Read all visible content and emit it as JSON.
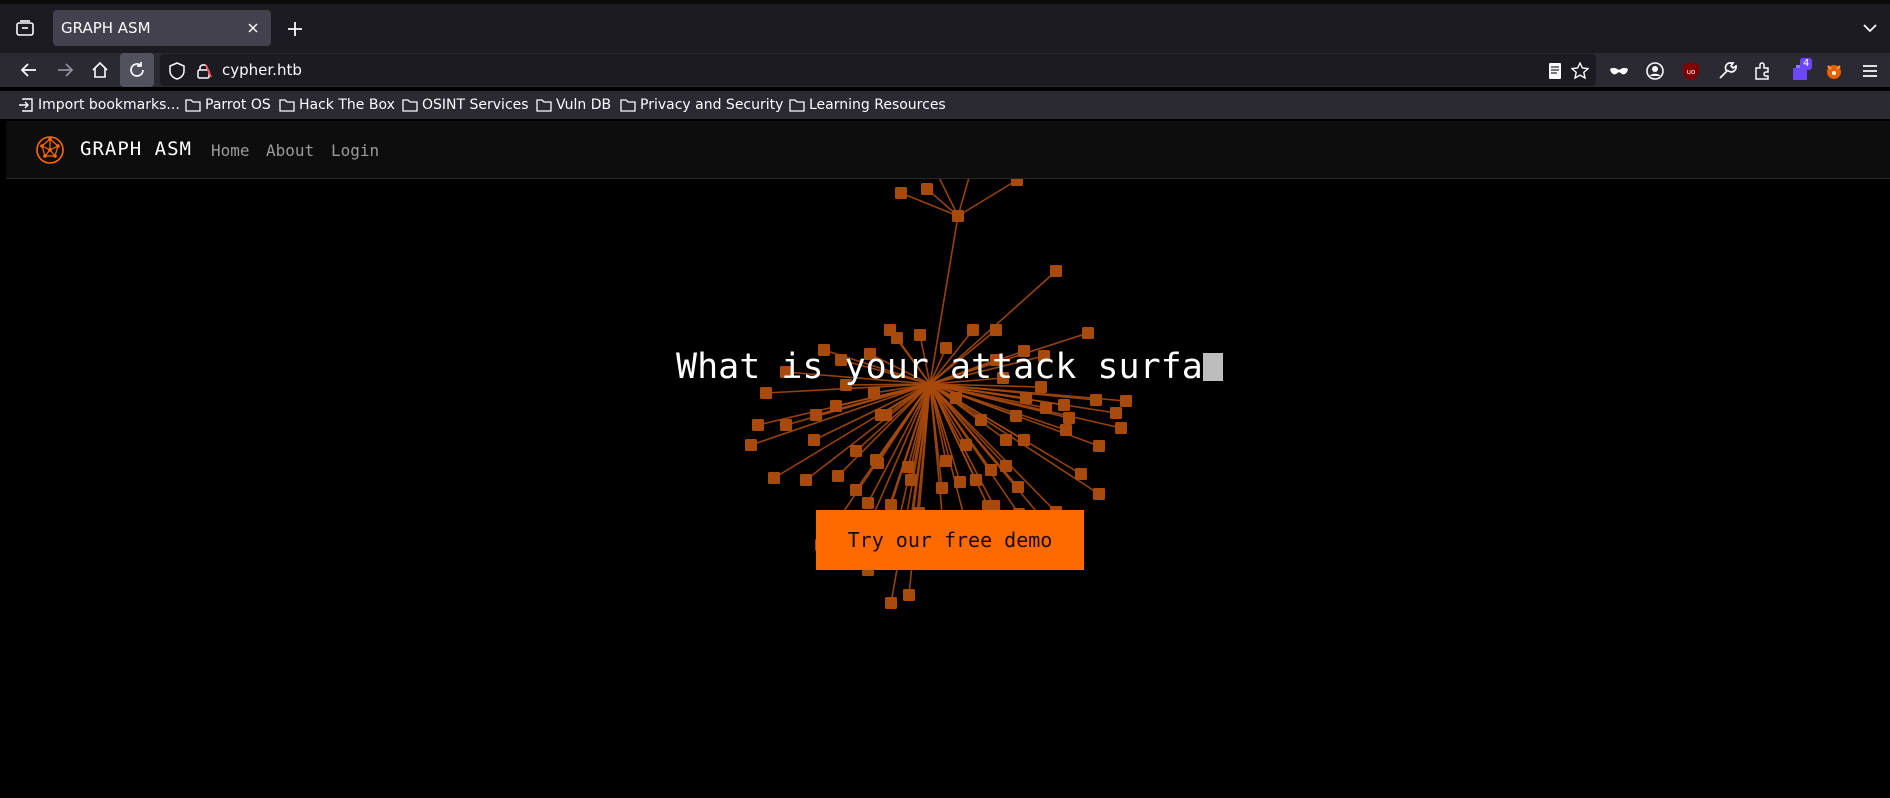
{
  "browser": {
    "tab_title": "GRAPH ASM",
    "url": "cypher.htb",
    "extension_badge": "4",
    "bookmarks": [
      {
        "label": "Import bookmarks...",
        "icon": "import-icon"
      },
      {
        "label": "Parrot OS",
        "icon": "folder-icon"
      },
      {
        "label": "Hack The Box",
        "icon": "folder-icon"
      },
      {
        "label": "OSINT Services",
        "icon": "folder-icon"
      },
      {
        "label": "Vuln DB",
        "icon": "folder-icon"
      },
      {
        "label": "Privacy and Security",
        "icon": "folder-icon"
      },
      {
        "label": "Learning Resources",
        "icon": "folder-icon"
      }
    ]
  },
  "site": {
    "brand": "GRAPH ASM",
    "nav": [
      "Home",
      "About",
      "Login"
    ],
    "headline": "What is your attack surfa",
    "cta": "Try our free demo",
    "accent_color": "#ff6a00",
    "node_color": "#a84a0c"
  }
}
